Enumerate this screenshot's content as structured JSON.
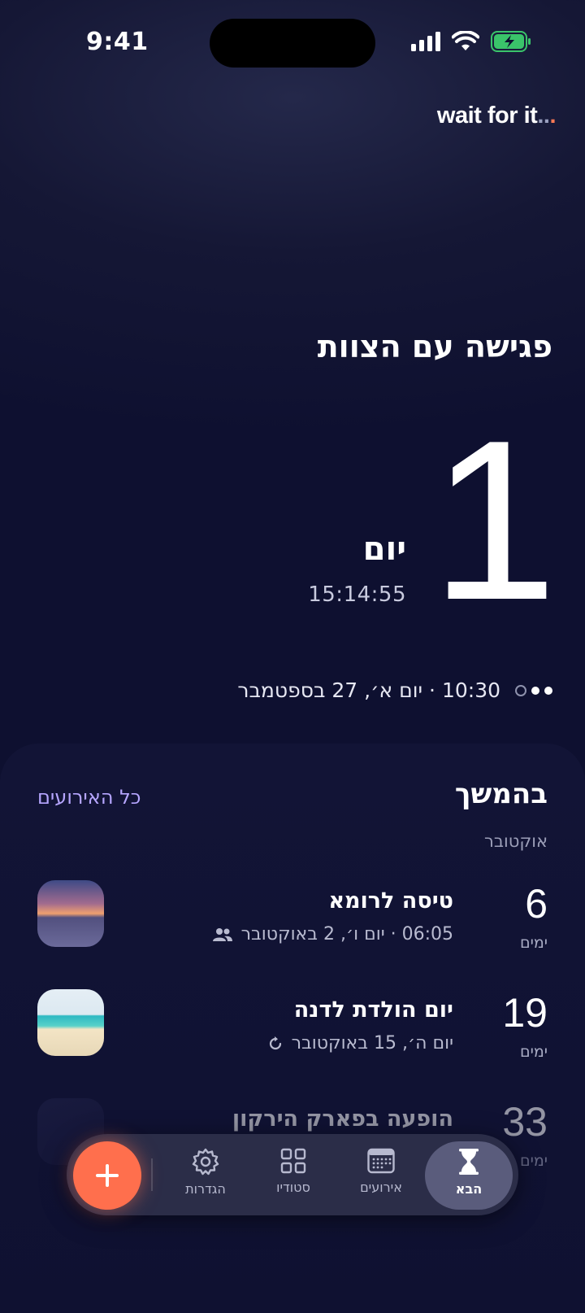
{
  "status_bar": {
    "time": "9:41"
  },
  "brand": {
    "text": "wait for it",
    "dots": "..",
    "accent_dot": "."
  },
  "hero": {
    "title": "פגישה עם הצוות",
    "count": "1",
    "unit": "יום",
    "clock": "15:14:55",
    "date_line": "10:30 · יום א׳, 27 בספטמבר"
  },
  "upcoming": {
    "title": "בהמשך",
    "all_link": "כל האירועים",
    "month": "אוקטובר",
    "items": [
      {
        "count": "6",
        "unit": "ימים",
        "title": "טיסה לרומא",
        "meta": "06:05 · יום ו׳, 2 באוקטובר",
        "meta_icon": "people-icon",
        "thumb": "sunset"
      },
      {
        "count": "19",
        "unit": "ימים",
        "title": "יום הולדת לדנה",
        "meta": "יום ה׳, 15 באוקטובר",
        "meta_icon": "repeat-icon",
        "thumb": "beach"
      },
      {
        "count": "33",
        "unit": "ימים",
        "title": "הופעה בפארק הירקון",
        "meta": "",
        "thumb": "dim"
      }
    ]
  },
  "tabbar": {
    "tabs": [
      {
        "label": "הגדרות",
        "icon": "gear-icon"
      },
      {
        "label": "סטודיו",
        "icon": "grid-icon"
      },
      {
        "label": "אירועים",
        "icon": "calendar-icon"
      },
      {
        "label": "הבא",
        "icon": "hourglass-icon",
        "active": true
      }
    ]
  },
  "colors": {
    "accent": "#ff6f4d",
    "link": "#b6a6ff",
    "background": "#0e1030"
  }
}
